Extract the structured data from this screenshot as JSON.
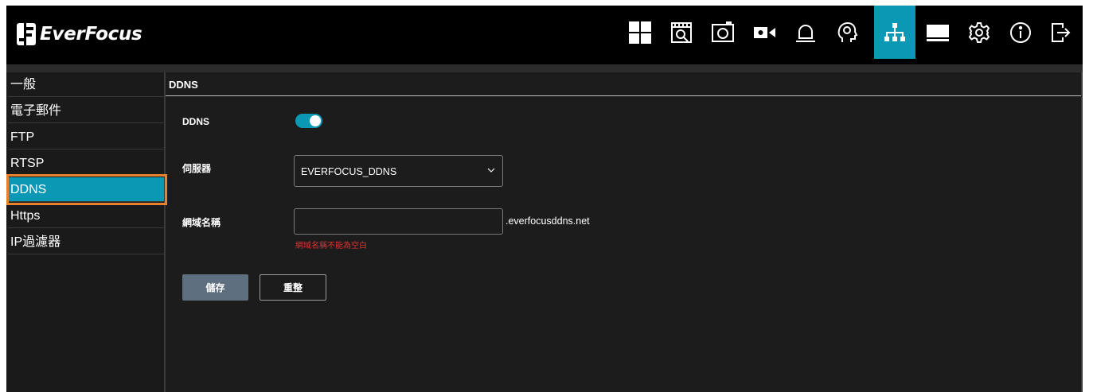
{
  "brand": {
    "name": "EverFocus"
  },
  "toolbar": {
    "icons": [
      "grid-layout-icon",
      "playback-search-icon",
      "snapshot-icon",
      "camera-icon",
      "alarm-bell-icon",
      "ai-head-icon",
      "network-icon",
      "storage-icon",
      "settings-gear-icon",
      "info-icon",
      "logout-icon"
    ],
    "active": "network-icon",
    "accent": "#0a98b4"
  },
  "sidebar": {
    "items": [
      {
        "label": "一般"
      },
      {
        "label": "電子郵件"
      },
      {
        "label": "FTP"
      },
      {
        "label": "RTSP"
      },
      {
        "label": "DDNS",
        "active": true
      },
      {
        "label": "Https"
      },
      {
        "label": "IP過濾器"
      }
    ],
    "highlight_color": "#e8822d"
  },
  "main": {
    "title": "DDNS",
    "ddns_label": "DDNS",
    "ddns_enabled": true,
    "server_label": "伺服器",
    "server_value": "EVERFOCUS_DDNS",
    "domain_label": "網域名稱",
    "domain_value": "",
    "domain_suffix": ".everfocusddns.net",
    "domain_error": "網域名稱不能為空白",
    "save_label": "儲存",
    "reset_label": "重整"
  }
}
